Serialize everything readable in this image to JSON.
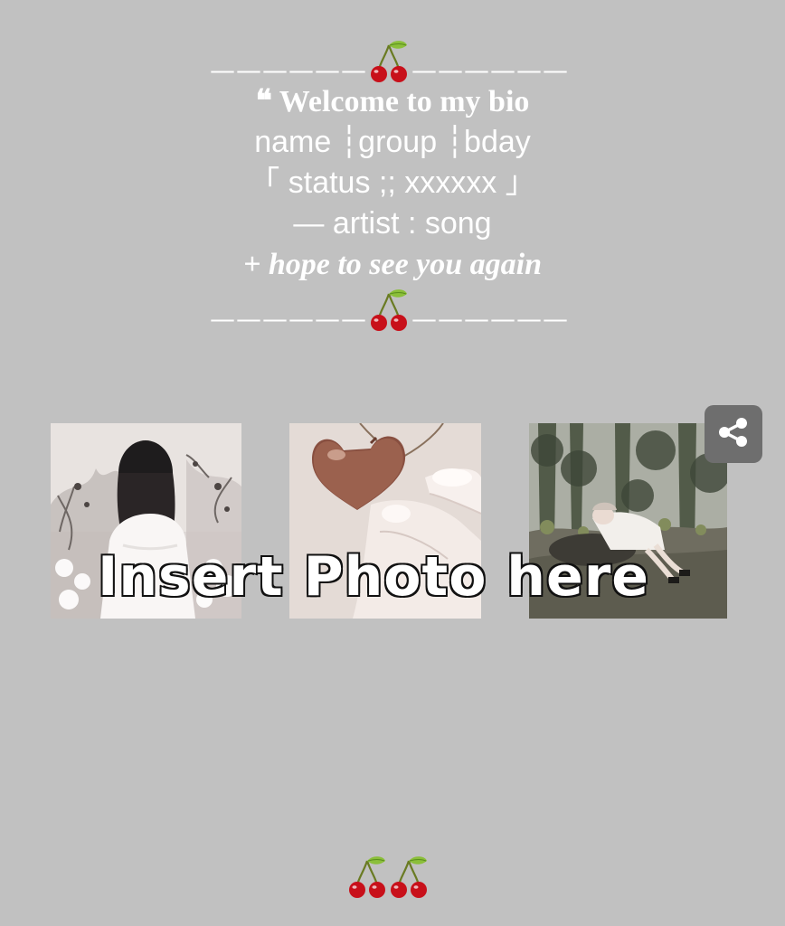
{
  "bio": {
    "divider_left": "——————",
    "divider_right": "——————",
    "welcome": "❝ Welcome to my bio",
    "name_line": "name ┆group ┆bday",
    "status_line": "「 status ;; xxxxxx 」",
    "artist_line": "— artist : song",
    "hope_line": "+ hope to see you again",
    "divider_icon": "cherry-icon"
  },
  "photos": {
    "items": [
      "photo-girl-flowers",
      "photo-heart-locket",
      "photo-girl-forest"
    ],
    "overlay_text": "Insert Photo here"
  },
  "share": {
    "icon": "share-icon",
    "color": "#6e6e6e"
  },
  "footer": {
    "icon": "cherry-icon"
  },
  "colors": {
    "background": "#c1c1c1",
    "text": "#ffffff",
    "cherry_red": "#c8101a",
    "leaf_green": "#8bbf3a"
  }
}
